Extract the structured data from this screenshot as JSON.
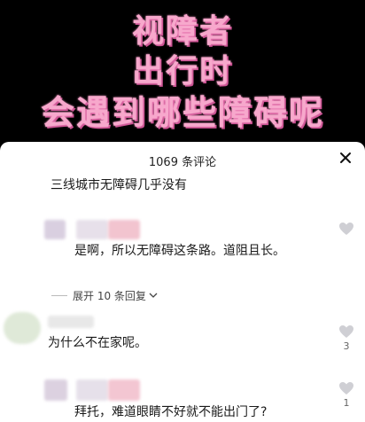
{
  "banner": {
    "line1": "视障者",
    "line2": "出行时",
    "line3": "会遇到哪些障碍呢"
  },
  "comments_panel": {
    "title": "1069 条评论",
    "close_icon": "close-icon"
  },
  "comments": [
    {
      "text": "三线城市无障碍几乎没有"
    },
    {
      "text": "是啊，所以无障碍这条路。道阻且长。",
      "likes": ""
    },
    {
      "expand_replies": "展开 10 条回复"
    },
    {
      "text": "为什么不在家呢。",
      "likes": "3"
    },
    {
      "text": "拜托，难道眼睛不好就不能出门了?",
      "likes": "1"
    }
  ],
  "colors": {
    "banner_text": "#f7a8cc",
    "background": "#000000",
    "sheet": "#ffffff"
  }
}
